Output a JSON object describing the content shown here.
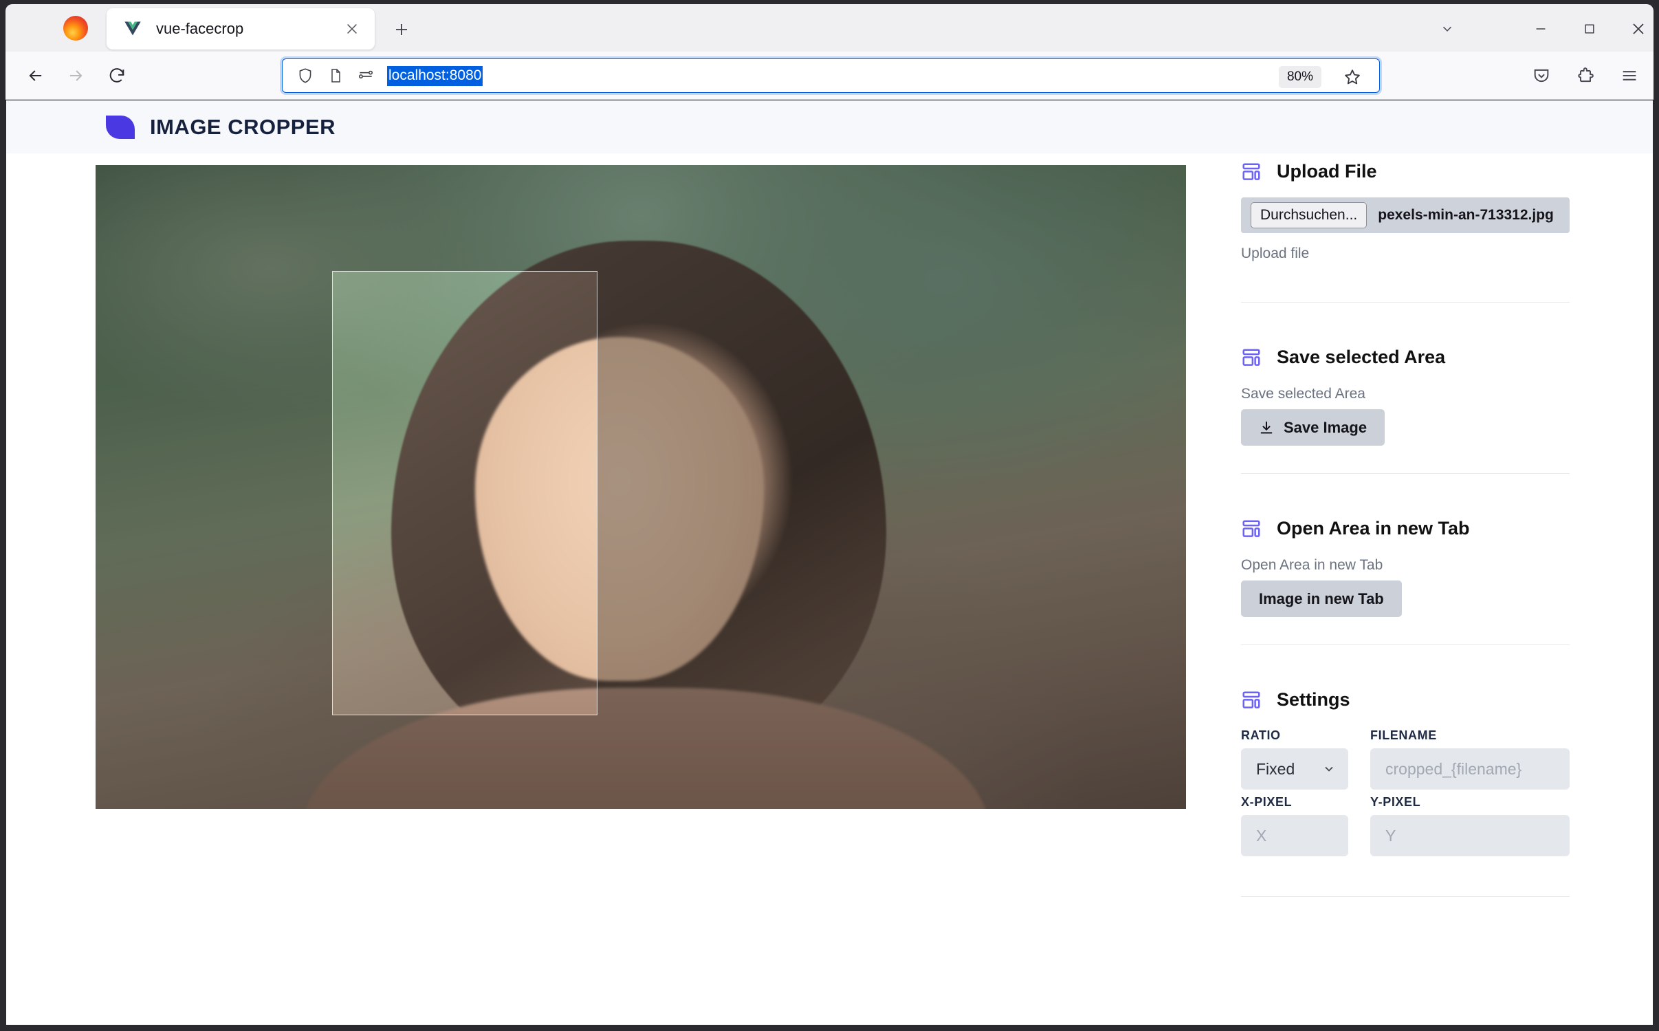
{
  "browser": {
    "tab": {
      "title": "vue-facecrop",
      "favicon": "vue-logo-icon"
    },
    "new_tab_label": "+",
    "url": "localhost:8080",
    "zoom_level": "80%",
    "window_controls": {
      "tablist": "chevron-down-icon",
      "minimize": "minimize-icon",
      "maximize": "maximize-icon",
      "close": "close-icon"
    },
    "toolbar_icons": {
      "back": "back-arrow-icon",
      "forward": "forward-arrow-icon",
      "reload": "reload-icon",
      "shield": "shield-icon",
      "page": "page-info-icon",
      "permissions": "permissions-icon",
      "bookmark": "star-icon",
      "pocket": "pocket-icon",
      "extensions": "extensions-puzzle-icon",
      "menu": "hamburger-menu-icon"
    }
  },
  "app": {
    "title": "IMAGE CROPPER",
    "accent_color": "#4a38e2",
    "icon_color": "#6c63f5"
  },
  "sidebar": {
    "upload": {
      "title": "Upload File",
      "browse_label": "Durchsuchen...",
      "file_name": "pexels-min-an-713312.jpg",
      "hint": "Upload file"
    },
    "save_area": {
      "title": "Save selected Area",
      "hint": "Save selected Area",
      "button_label": "Save Image"
    },
    "open_tab": {
      "title": "Open Area in new Tab",
      "hint": "Open Area in new Tab",
      "button_label": "Image in new Tab"
    },
    "settings": {
      "title": "Settings",
      "ratio_label": "RATIO",
      "ratio_value": "Fixed",
      "filename_label": "FILENAME",
      "filename_placeholder": "cropped_{filename}",
      "x_label": "X-PIXEL",
      "x_placeholder": "X",
      "y_label": "Y-PIXEL",
      "y_placeholder": "Y"
    }
  },
  "canvas": {
    "image_alt": "portrait-photo",
    "crop_selection": "crop-selection-box"
  }
}
